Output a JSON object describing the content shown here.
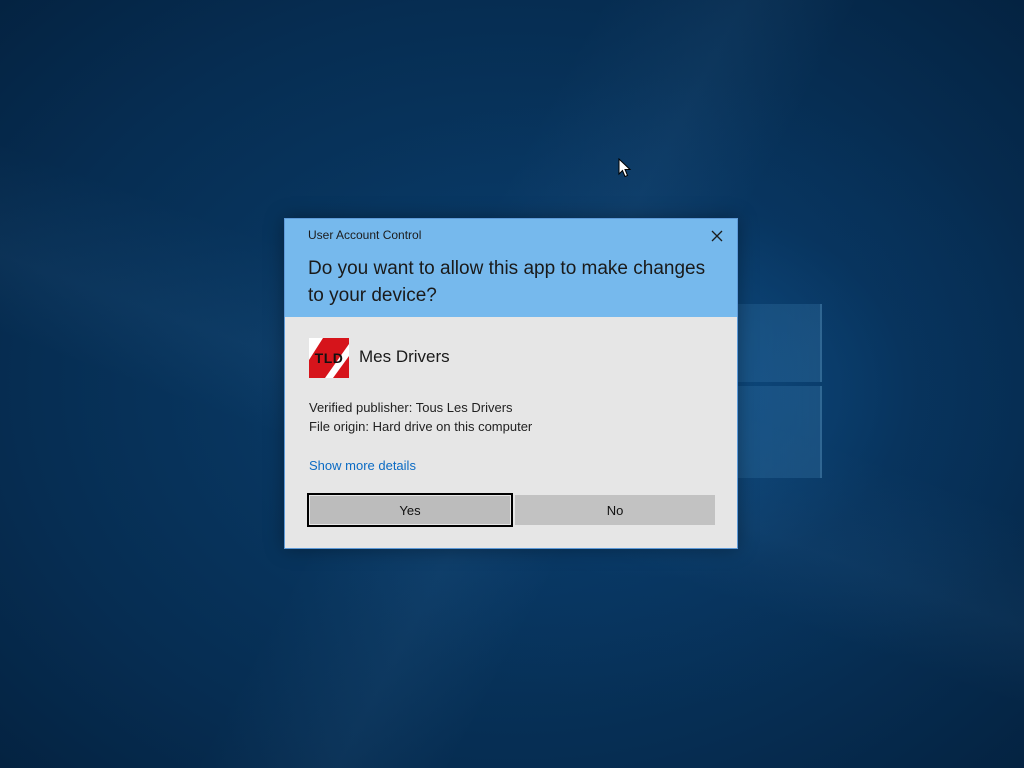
{
  "uac": {
    "caption": "User Account Control",
    "question": "Do you want to allow this app to make changes to your device?",
    "app_name": "Mes Drivers",
    "app_icon": "tld-logo-icon",
    "app_icon_text": "TLD",
    "publisher": "Verified publisher: Tous Les Drivers",
    "origin": "File origin: Hard drive on this computer",
    "more_details": "Show more details",
    "yes_label": "Yes",
    "no_label": "No",
    "close_icon": "close-icon"
  },
  "colors": {
    "header": "#76b9ed",
    "body": "#e6e6e6",
    "link": "#0b6bc4",
    "button": "#c0c0c0"
  }
}
